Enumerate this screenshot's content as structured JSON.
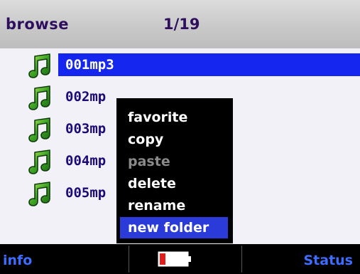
{
  "header": {
    "title": "browse",
    "count": "1/19"
  },
  "files": [
    {
      "name": "001mp3",
      "icon": "music-note-icon",
      "selected": true
    },
    {
      "name": "002mp",
      "icon": "music-note-icon",
      "selected": false
    },
    {
      "name": "003mp",
      "icon": "music-note-icon",
      "selected": false
    },
    {
      "name": "004mp",
      "icon": "music-note-icon",
      "selected": false
    },
    {
      "name": "005mp",
      "icon": "music-note-icon",
      "selected": false
    }
  ],
  "context_menu": {
    "items": [
      {
        "label": "favorite",
        "state": "normal"
      },
      {
        "label": "copy",
        "state": "normal"
      },
      {
        "label": "paste",
        "state": "disabled"
      },
      {
        "label": "delete",
        "state": "normal"
      },
      {
        "label": "rename",
        "state": "normal"
      },
      {
        "label": "new folder",
        "state": "highlighted"
      }
    ]
  },
  "footer": {
    "left": "info",
    "right": "Status",
    "battery": {
      "icon": "battery-icon",
      "level": 0.3
    }
  },
  "colors": {
    "selection": "#1527ee",
    "menu_highlight": "#2a3bd9",
    "footer_text": "#3d6cff",
    "file_text": "#1b0a78",
    "icon_green": "#2f8a1e"
  }
}
